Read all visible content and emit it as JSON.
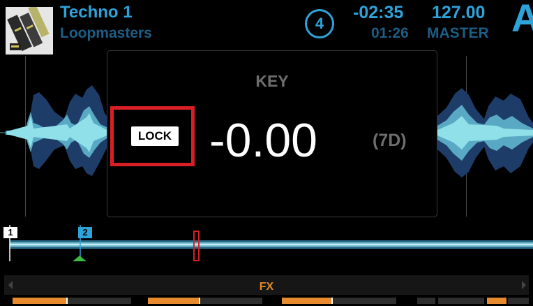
{
  "header": {
    "track_title": "Techno 1",
    "track_artist": "Loopmasters",
    "deck_number": "4",
    "remaining_time": "-02:35",
    "bpm": "127.00",
    "elapsed_time": "01:26",
    "tempo_source": "MASTER",
    "deck_letter": "A"
  },
  "key_panel": {
    "heading": "KEY",
    "lock_label": "LOCK",
    "value": "-0.00",
    "notation": "(7D)"
  },
  "overview": {
    "cue_points": [
      "1",
      "2"
    ]
  },
  "fx_bar": {
    "label": "FX",
    "slots": [
      {
        "level": 0.86,
        "color": "#e88b2e"
      },
      {
        "level": 0.0,
        "color": "#e88b2e"
      },
      {
        "level": 0.87,
        "color": "#e88b2e"
      },
      {
        "level": 0.0,
        "color": "#e88b2e"
      },
      {
        "level": 0.85,
        "color": "#e88b2e"
      },
      {
        "level": 0.0,
        "color": "#e88b2e"
      },
      {
        "level": 0.0,
        "color": "#e88b2e"
      },
      {
        "level": 0.0,
        "color": "#e88b2e"
      },
      {
        "level": 1.0,
        "color": "#e88b2e"
      },
      {
        "level": 0.0,
        "color": "#e88b2e"
      }
    ]
  },
  "colors": {
    "accent": "#2ea3da",
    "accent_dim": "#1d5e86",
    "lock_highlight": "#d81f26",
    "fx_orange": "#e88b2e",
    "key_gray": "#6e6e6e",
    "cue_green": "#3dbb3d"
  },
  "icons": {
    "lock_highlight": "red-rectangle",
    "fx_left": "triangle-left-icon",
    "fx_right": "triangle-right-icon"
  }
}
